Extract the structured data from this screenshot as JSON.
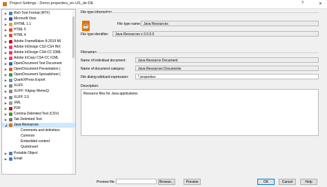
{
  "window": {
    "title": "Project Settings - Demo.properties_en-US_de-DE",
    "help": "?",
    "close": "✕"
  },
  "tree": {
    "items": [
      {
        "label": "Rich Text Format (RTF)",
        "icon_color": "#4a7ebb",
        "expander": "▶",
        "indent": 0
      },
      {
        "label": "Microsoft Visio",
        "icon_color": "#3955a3",
        "expander": "▶",
        "indent": 0
      },
      {
        "label": "XHTML 1.1",
        "icon_color": "#e0a030",
        "expander": "▶",
        "indent": 0
      },
      {
        "label": "HTML 5",
        "icon_color": "#e34c26",
        "expander": "▶",
        "indent": 0
      },
      {
        "label": "HTML 4",
        "icon_color": "#e34c26",
        "expander": "▶",
        "indent": 0
      },
      {
        "label": "Adobe FrameMaker 8-2019 MI",
        "icon_color": "#c8102e",
        "expander": "▶",
        "indent": 0
      },
      {
        "label": "Adobe InDesign CS2-CS4 INX",
        "icon_color": "#ff3366",
        "expander": "▶",
        "indent": 0
      },
      {
        "label": "Adobe InDesign CS4-CC IDML",
        "icon_color": "#ff3366",
        "expander": "▶",
        "indent": 0
      },
      {
        "label": "Adobe InCopy CS4-CC ICML",
        "icon_color": "#ff3366",
        "expander": "▶",
        "indent": 0
      },
      {
        "label": "OpenDocument Text Document",
        "icon_color": "#2a6ebb",
        "expander": "▶",
        "indent": 0
      },
      {
        "label": "OpenDocument Presentation (",
        "icon_color": "#d9622b",
        "expander": "▶",
        "indent": 0
      },
      {
        "label": "OpenDocument Spreadsheet (",
        "icon_color": "#3a9b3a",
        "expander": "▶",
        "indent": 0
      },
      {
        "label": "QuarkXPress Export",
        "icon_color": "#6a8fbf",
        "expander": "▶",
        "indent": 0
      },
      {
        "label": "XLIFF",
        "icon_color": "#888888",
        "expander": "▶",
        "indent": 0
      },
      {
        "label": "XLIFF: Kilgray MemoQ",
        "icon_color": "#888888",
        "expander": "▶",
        "indent": 0
      },
      {
        "label": "XLIFF 2.0",
        "icon_color": "#888888",
        "expander": "▶",
        "indent": 0
      },
      {
        "label": "XML",
        "icon_color": "#999999",
        "expander": "▶",
        "indent": 0
      },
      {
        "label": "PDF",
        "icon_color": "#c8102e",
        "expander": "▶",
        "indent": 0
      },
      {
        "label": "Comma Delimited Text (CSV)",
        "icon_color": "#3a9b3a",
        "expander": "▶",
        "indent": 0
      },
      {
        "label": "Tab Delimited Text",
        "icon_color": "#777777",
        "expander": "▶",
        "indent": 0
      },
      {
        "label": "Java Resources",
        "icon_color": "#e76f00",
        "expander": "◢",
        "indent": 0,
        "selected": true
      },
      {
        "label": "Comments and delimiters",
        "icon_color": "",
        "expander": "",
        "indent": 1
      },
      {
        "label": "Common",
        "icon_color": "",
        "expander": "",
        "indent": 1
      },
      {
        "label": "Embedded content",
        "icon_color": "",
        "expander": "",
        "indent": 1
      },
      {
        "label": "QuickInsert",
        "icon_color": "",
        "expander": "",
        "indent": 1
      },
      {
        "label": "Portable Object",
        "icon_color": "#4a7ebb",
        "expander": "▶",
        "indent": 0
      },
      {
        "label": "Email",
        "icon_color": "#4a7ebb",
        "expander": "▶",
        "indent": 0
      }
    ]
  },
  "filetype": {
    "section_title": "File type information",
    "logo_text": "☕",
    "name_label": "File type name:",
    "name_value": "Java Resources",
    "id_label": "File type identifier:",
    "id_value": "Java Resources v 2.0.0.0"
  },
  "filenames": {
    "section_title": "Filenames",
    "doc_label": "Name of individual document:",
    "doc_value": "Java Resource Document",
    "cat_label": "Name of document category:",
    "cat_value": "Java Resources Documents",
    "wildcard_label": "File dialog wildcard expression:",
    "wildcard_value": "*.properties"
  },
  "description": {
    "label": "Description:",
    "text": "Resource files for Java applications"
  },
  "bottom": {
    "preview_label": "Preview file:",
    "preview_value": "",
    "browse": "Browse...",
    "preview": "Preview",
    "ok": "OK",
    "cancel": "Cancel",
    "help": "Help"
  }
}
